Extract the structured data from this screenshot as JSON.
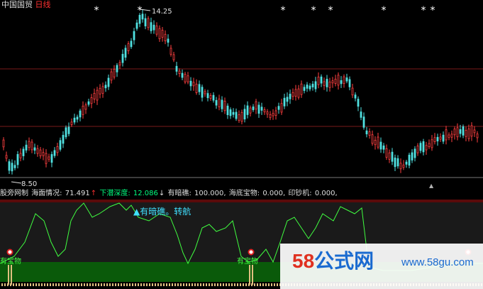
{
  "header": {
    "stock_name": "中国国贸",
    "period": "日线",
    "colors": {
      "name": "#e0e0e0",
      "period": "#ff3030"
    }
  },
  "main_chart": {
    "high_label": "14.25",
    "low_label": "8.50",
    "price_range": [
      8.2,
      15.2
    ],
    "star_marker": "*",
    "up_arrow_marker": "▲",
    "candle_colors": {
      "up": "#ff4040",
      "down": "#50e0e0"
    },
    "gridline_color": "#7a1a1a"
  },
  "indicator": {
    "name": "股旁网制",
    "items": [
      {
        "label": "海面情况:",
        "value": "71.491",
        "arrow": "↑",
        "color": "#e0e0e0",
        "arrow_color": "#ff3030"
      },
      {
        "label": "下潜深度:",
        "value": "12.086",
        "arrow": "↓",
        "color": "#00ff7f",
        "arrow_color": "#e0e0e0"
      },
      {
        "label": "有暗礁:",
        "value": "100.000,",
        "color": "#e0e0e0"
      },
      {
        "label": "海底宝物:",
        "value": "0.000,",
        "color": "#e0e0e0"
      },
      {
        "label": "印钞机:",
        "value": "0.000,",
        "color": "#e0e0e0"
      }
    ]
  },
  "sub_chart": {
    "annotation": "▲有暗礁。转航",
    "treasure_label": "有宝物",
    "line_color": "#40ff40",
    "band_color": "#0a5a0a"
  },
  "watermark": {
    "logo_number": "58",
    "logo_text": "公式网",
    "url": "www.58gu.com"
  }
}
